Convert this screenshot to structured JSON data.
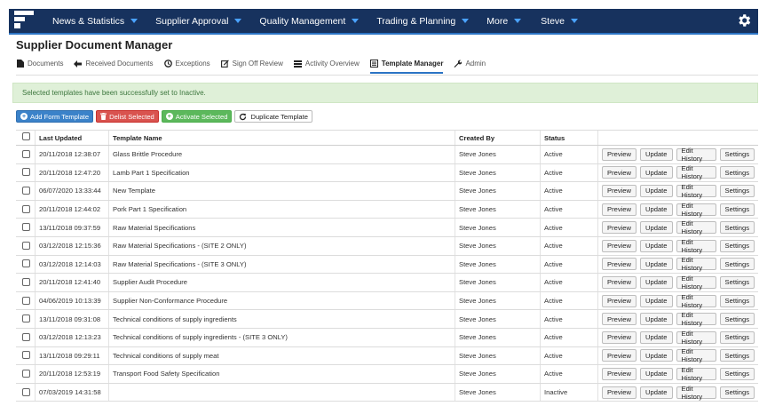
{
  "nav": {
    "items": [
      {
        "label": "News & Statistics"
      },
      {
        "label": "Supplier Approval"
      },
      {
        "label": "Quality Management"
      },
      {
        "label": "Trading & Planning"
      },
      {
        "label": "More"
      },
      {
        "label": "Steve"
      }
    ],
    "brand_color": "#17325e",
    "accent_color": "#2b74c4"
  },
  "page_title": "Supplier Document Manager",
  "tabs": [
    {
      "label": "Documents",
      "icon": "file-icon"
    },
    {
      "label": "Received Documents",
      "icon": "arrow-left-icon"
    },
    {
      "label": "Exceptions",
      "icon": "clock-icon"
    },
    {
      "label": "Sign Off Review",
      "icon": "edit-icon"
    },
    {
      "label": "Activity Overview",
      "icon": "list-icon"
    },
    {
      "label": "Template Manager",
      "icon": "document-list-icon",
      "active": true
    },
    {
      "label": "Admin",
      "icon": "wrench-icon"
    }
  ],
  "alert": "Selected templates have been successfully set to Inactive.",
  "actions": {
    "add": "Add Form Template",
    "delist": "Delist Selected",
    "activate": "Activate Selected",
    "duplicate": "Duplicate Template"
  },
  "table": {
    "headers": {
      "last_updated": "Last Updated",
      "template_name": "Template Name",
      "created_by": "Created By",
      "status": "Status"
    },
    "row_buttons": {
      "preview": "Preview",
      "update": "Update",
      "edit_history": "Edit History",
      "settings": "Settings"
    },
    "rows": [
      {
        "last_updated": "20/11/2018 12:38:07",
        "template_name": "Glass Brittle Procedure",
        "created_by": "Steve Jones",
        "status": "Active"
      },
      {
        "last_updated": "20/11/2018 12:47:20",
        "template_name": "Lamb Part 1 Specification",
        "created_by": "Steve Jones",
        "status": "Active"
      },
      {
        "last_updated": "06/07/2020 13:33:44",
        "template_name": "New Template",
        "created_by": "Steve Jones",
        "status": "Active"
      },
      {
        "last_updated": "20/11/2018 12:44:02",
        "template_name": "Pork Part 1 Specification",
        "created_by": "Steve Jones",
        "status": "Active"
      },
      {
        "last_updated": "13/11/2018 09:37:59",
        "template_name": "Raw Material Specifications",
        "created_by": "Steve Jones",
        "status": "Active"
      },
      {
        "last_updated": "03/12/2018 12:15:36",
        "template_name": "Raw Material Specifications - (SITE 2 ONLY)",
        "created_by": "Steve Jones",
        "status": "Active"
      },
      {
        "last_updated": "03/12/2018 12:14:03",
        "template_name": "Raw Material Specifications - (SITE 3 ONLY)",
        "created_by": "Steve Jones",
        "status": "Active"
      },
      {
        "last_updated": "20/11/2018 12:41:40",
        "template_name": "Supplier Audit Procedure",
        "created_by": "Steve Jones",
        "status": "Active"
      },
      {
        "last_updated": "04/06/2019 10:13:39",
        "template_name": "Supplier Non-Conformance Procedure",
        "created_by": "Steve Jones",
        "status": "Active"
      },
      {
        "last_updated": "13/11/2018 09:31:08",
        "template_name": "Technical conditions of supply ingredients",
        "created_by": "Steve Jones",
        "status": "Active"
      },
      {
        "last_updated": "03/12/2018 12:13:23",
        "template_name": "Technical conditions of supply ingredients - (SITE 3 ONLY)",
        "created_by": "Steve Jones",
        "status": "Active"
      },
      {
        "last_updated": "13/11/2018 09:29:11",
        "template_name": "Technical conditions of supply meat",
        "created_by": "Steve Jones",
        "status": "Active"
      },
      {
        "last_updated": "20/11/2018 12:53:19",
        "template_name": "Transport Food Safety Specification",
        "created_by": "Steve Jones",
        "status": "Active"
      },
      {
        "last_updated": "07/03/2019 14:31:58",
        "template_name": "",
        "created_by": "Steve Jones",
        "status": "Inactive"
      }
    ]
  }
}
